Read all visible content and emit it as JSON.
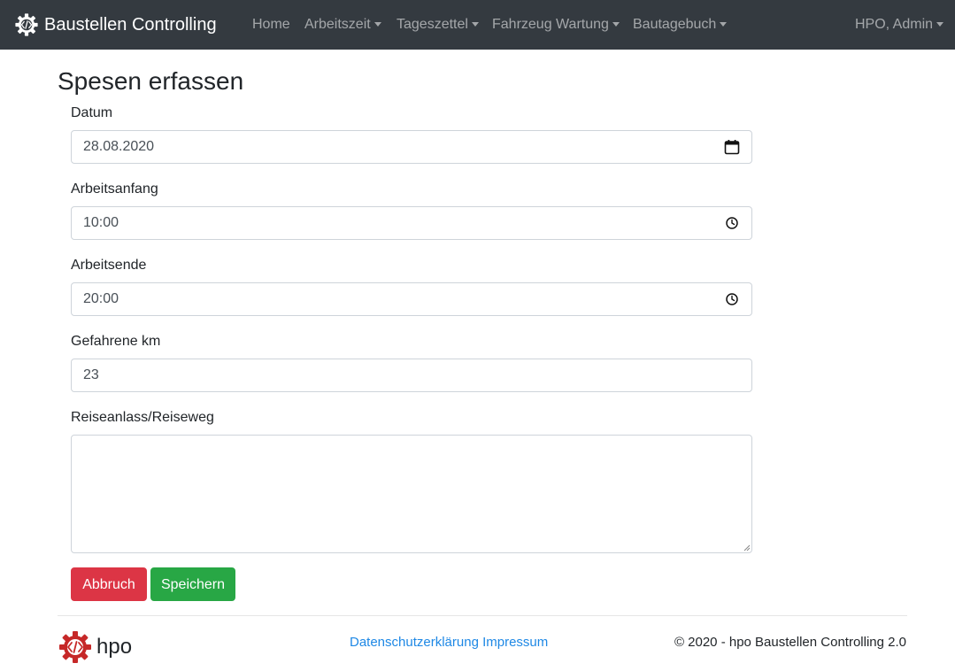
{
  "navbar": {
    "brand": "Baustellen Controlling",
    "brand_icon": "gear-code-icon",
    "items": [
      {
        "label": "Home",
        "dropdown": false
      },
      {
        "label": "Arbeitszeit",
        "dropdown": true
      },
      {
        "label": "Tageszettel",
        "dropdown": true
      },
      {
        "label": "Fahrzeug Wartung",
        "dropdown": true
      },
      {
        "label": "Bautagebuch",
        "dropdown": true
      }
    ],
    "user": {
      "label": "HPO, Admin",
      "dropdown": true
    },
    "background": "#343a40"
  },
  "page": {
    "title": "Spesen erfassen"
  },
  "form": {
    "datum": {
      "label": "Datum",
      "value": "28.08.2020",
      "icon": "calendar-icon"
    },
    "arbeitsanfang": {
      "label": "Arbeitsanfang",
      "value": "10:00",
      "icon": "clock-icon"
    },
    "arbeitsende": {
      "label": "Arbeitsende",
      "value": "20:00",
      "icon": "clock-icon"
    },
    "km": {
      "label": "Gefahrene km",
      "value": "23"
    },
    "reiseanlass": {
      "label": "Reiseanlass/Reiseweg",
      "value": ""
    },
    "cancel_label": "Abbruch",
    "save_label": "Speichern"
  },
  "footer": {
    "logo_text": "hpo",
    "logo_icon": "gear-code-icon",
    "links": [
      "Datenschutzerklärung",
      "Impressum"
    ],
    "copyright": "© 2020 - hpo Baustellen Controlling 2.0"
  },
  "colors": {
    "danger": "#dc3545",
    "success": "#28a745",
    "link": "#1e88e5",
    "logo_red": "#c62828"
  }
}
